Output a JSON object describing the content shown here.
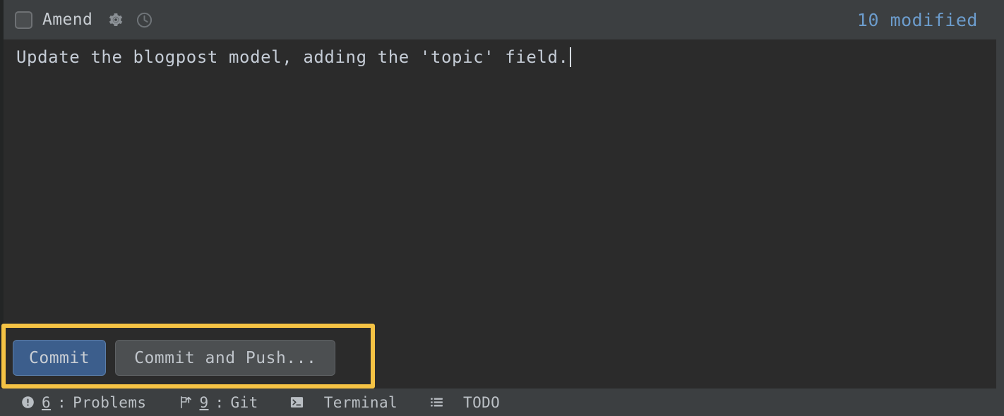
{
  "toolbar": {
    "amend_checkbox_label": "Amend",
    "amend_checked": false,
    "gear_icon": "gear-icon",
    "history_icon": "clock-icon",
    "modified_status": "10 modified",
    "modified_color": "#6c9ccc",
    "background_color": "#3c3f41"
  },
  "editor": {
    "commit_message": "Update the blogpost model, adding the 'topic' field.",
    "has_caret": true,
    "text_color": "#c5ccd6",
    "background_color": "#2b2b2b"
  },
  "actions": {
    "highlight_color": "#f5c344",
    "commit_label": "Commit",
    "commit_and_push_label": "Commit and Push...",
    "primary_color": "#3c5e8c"
  },
  "statusbar": {
    "background_color": "#3c3f41",
    "items": [
      {
        "icon": "error-circle-icon",
        "shortcut": "6",
        "separator": ": ",
        "label": "Problems"
      },
      {
        "icon": "git-branch-icon",
        "shortcut": "9",
        "separator": ": ",
        "label": "Git"
      },
      {
        "icon": "terminal-icon",
        "shortcut": "",
        "separator": "",
        "label": "Terminal"
      },
      {
        "icon": "todo-list-icon",
        "shortcut": "",
        "separator": "",
        "label": "TODO"
      }
    ]
  }
}
